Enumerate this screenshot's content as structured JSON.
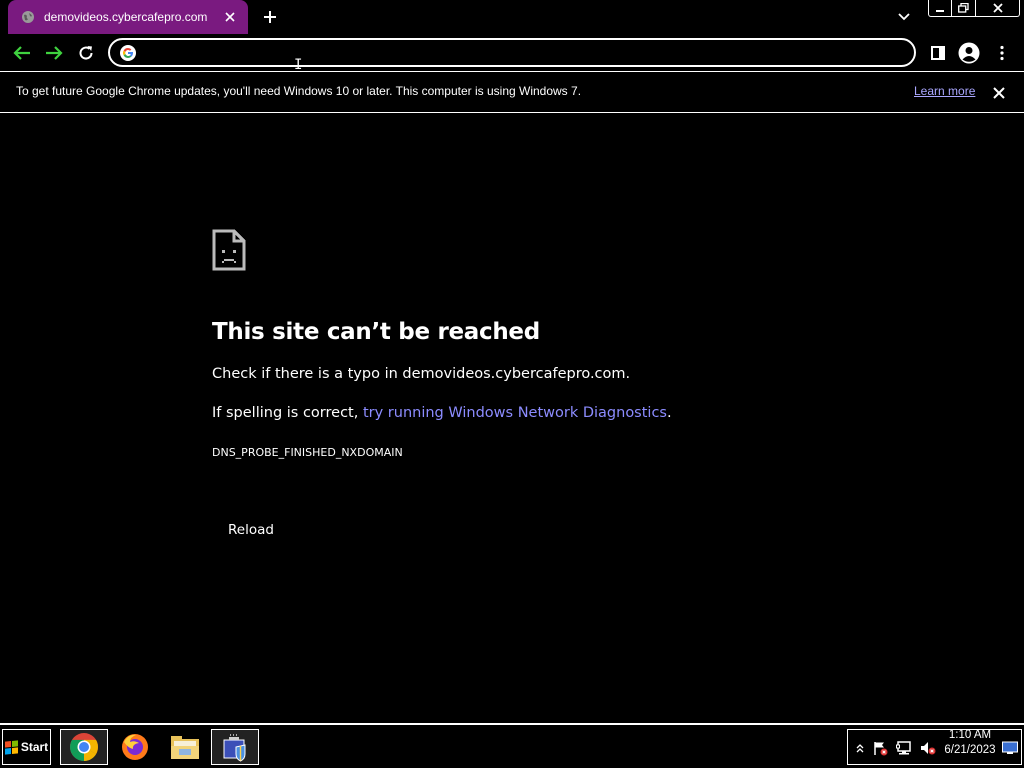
{
  "browser": {
    "tab": {
      "title": "demovideos.cybercafepro.com",
      "favicon": "globe-icon"
    },
    "omnibox": {
      "value": "",
      "placeholder": ""
    }
  },
  "infobar": {
    "message": "To get future Google Chrome updates, you'll need Windows 10 or later. This computer is using Windows 7.",
    "learn_more": "Learn more"
  },
  "error_page": {
    "icon": "sad-page-icon",
    "heading": "This site can’t be reached",
    "check_text": "Check if there is a typo in demovideos.cybercafepro.com.",
    "spelling_prefix": "If spelling is correct, ",
    "diagnostics_link": "try running Windows Network Diagnostics",
    "spelling_suffix": ".",
    "error_code": "DNS_PROBE_FINISHED_NXDOMAIN",
    "reload_button": "Reload"
  },
  "taskbar": {
    "start_label": "Start",
    "apps": [
      "chrome-icon",
      "firefox-icon",
      "file-explorer-icon",
      "cybercafe-client-icon"
    ],
    "clock": {
      "time": "1:10 AM",
      "date": "6/21/2023"
    }
  },
  "colors": {
    "tab_active": "#7a1a80",
    "link": "#8c8cff",
    "nav_arrow": "#3fd23f",
    "background": "#000000"
  }
}
